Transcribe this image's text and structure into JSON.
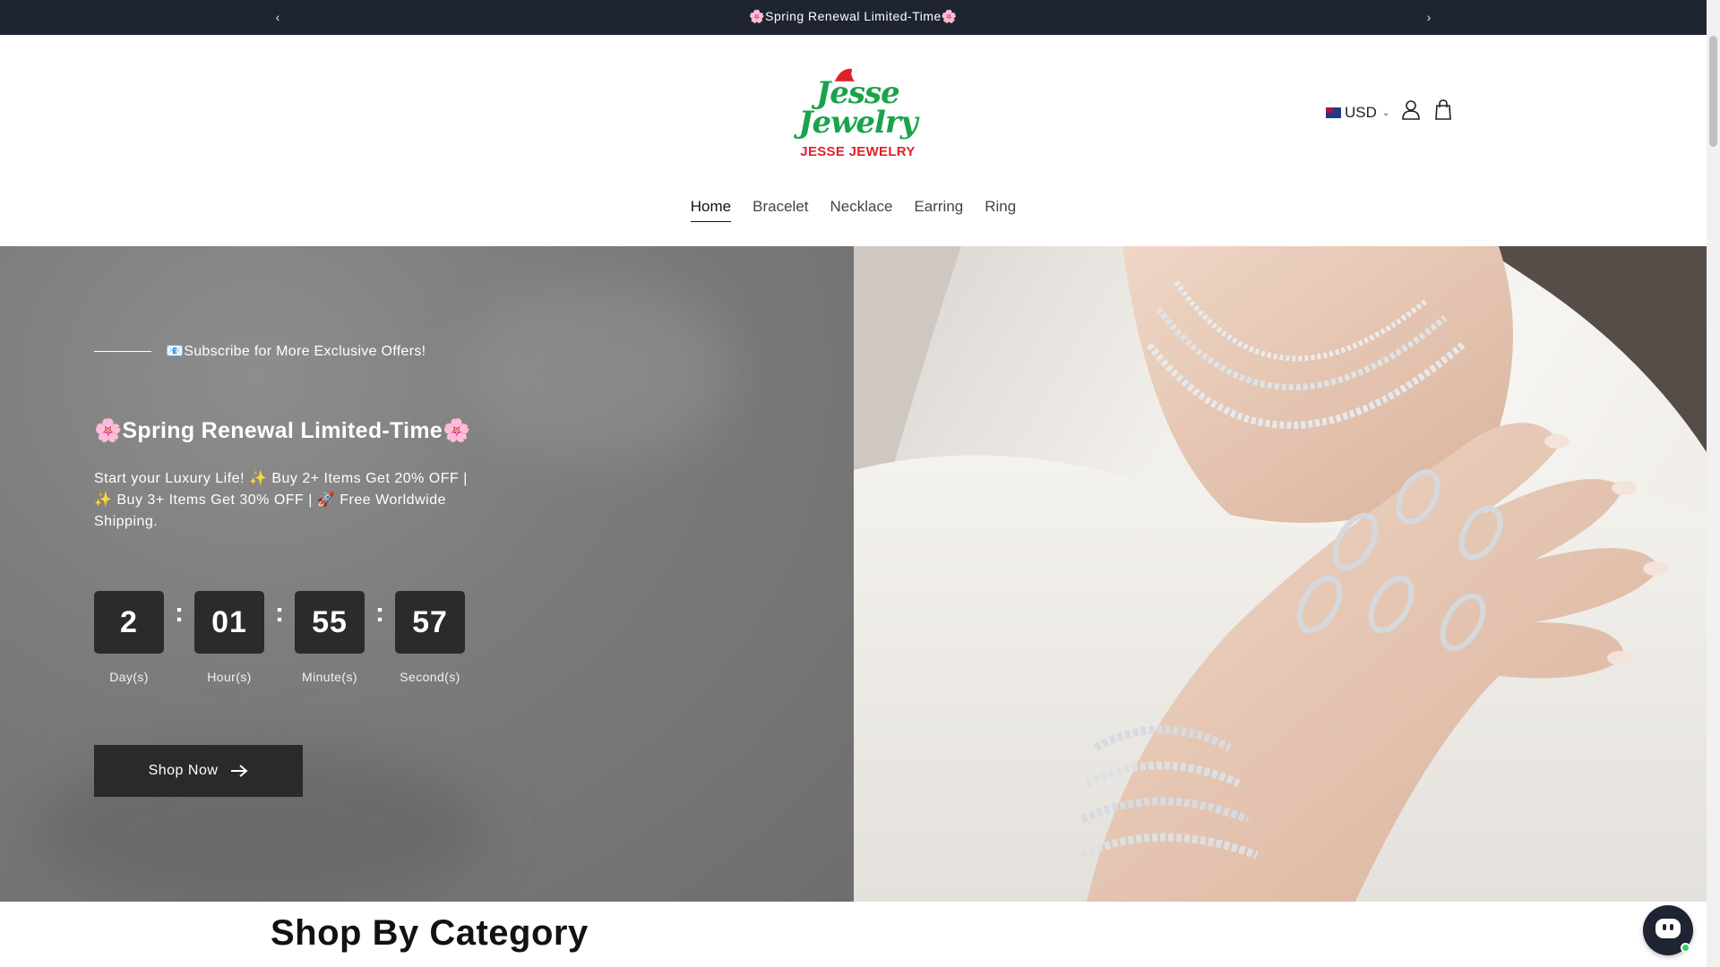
{
  "announcement": {
    "text": "🌸Spring Renewal Limited-Time🌸",
    "prev_icon": "chevron-left-icon",
    "next_icon": "chevron-right-icon"
  },
  "header": {
    "logo": {
      "script_line1": "Jesse",
      "script_line2": "Jewelry",
      "wordmark": "JESSE JEWELRY",
      "script_color": "#1aa34a",
      "wordmark_color": "#e0212b"
    },
    "currency": "USD",
    "account_icon": "user-icon",
    "cart_icon": "shopping-bag-icon"
  },
  "nav": {
    "items": [
      {
        "label": "Home",
        "active": true
      },
      {
        "label": "Bracelet",
        "active": false
      },
      {
        "label": "Necklace",
        "active": false
      },
      {
        "label": "Earring",
        "active": false
      },
      {
        "label": "Ring",
        "active": false
      }
    ]
  },
  "hero": {
    "subscribe_text": "📧Subscribe for More Exclusive Offers!",
    "title": "🌸Spring Renewal Limited-Time🌸",
    "description": "Start your Luxury Life! ✨ Buy 2+ Items Get 20% OFF  |  ✨ Buy 3+ Items Get 30% OFF |  🚀 Free Worldwide Shipping.",
    "countdown": {
      "days": "2",
      "days_label": "Day(s)",
      "hours": "01",
      "hours_label": "Hour(s)",
      "minutes": "55",
      "minutes_label": "Minute(s)",
      "seconds": "57",
      "seconds_label": "Second(s)",
      "separator": ":"
    },
    "cta_label": "Shop Now",
    "cta_icon": "arrow-right-icon"
  },
  "section": {
    "title": "Shop By Category"
  },
  "chat": {
    "icon": "chat-bot-icon",
    "status_color": "#2fd15a"
  },
  "colors": {
    "announcement_bg": "#1f2432",
    "button_bg": "#2a2a2a"
  }
}
